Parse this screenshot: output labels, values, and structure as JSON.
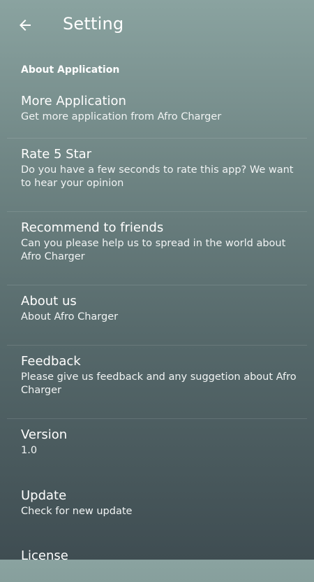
{
  "header": {
    "title": "Setting",
    "back_icon": "arrow-left-icon"
  },
  "section": {
    "title": "About Application"
  },
  "items": [
    {
      "title": "More Application",
      "subtitle": "Get more application from Afro Charger"
    },
    {
      "title": "Rate 5 Star",
      "subtitle": "Do you have a few seconds to rate this app? We want to hear your opinion"
    },
    {
      "title": "Recommend to friends",
      "subtitle": "Can you please help us to spread in the world about Afro Charger"
    },
    {
      "title": "About us",
      "subtitle": "About Afro Charger"
    },
    {
      "title": "Feedback",
      "subtitle": "Please give us feedback and any suggetion about Afro Charger"
    },
    {
      "title": "Version",
      "subtitle": "1.0"
    },
    {
      "title": "Update",
      "subtitle": "Check for new update"
    },
    {
      "title": "License",
      "subtitle": ""
    }
  ]
}
